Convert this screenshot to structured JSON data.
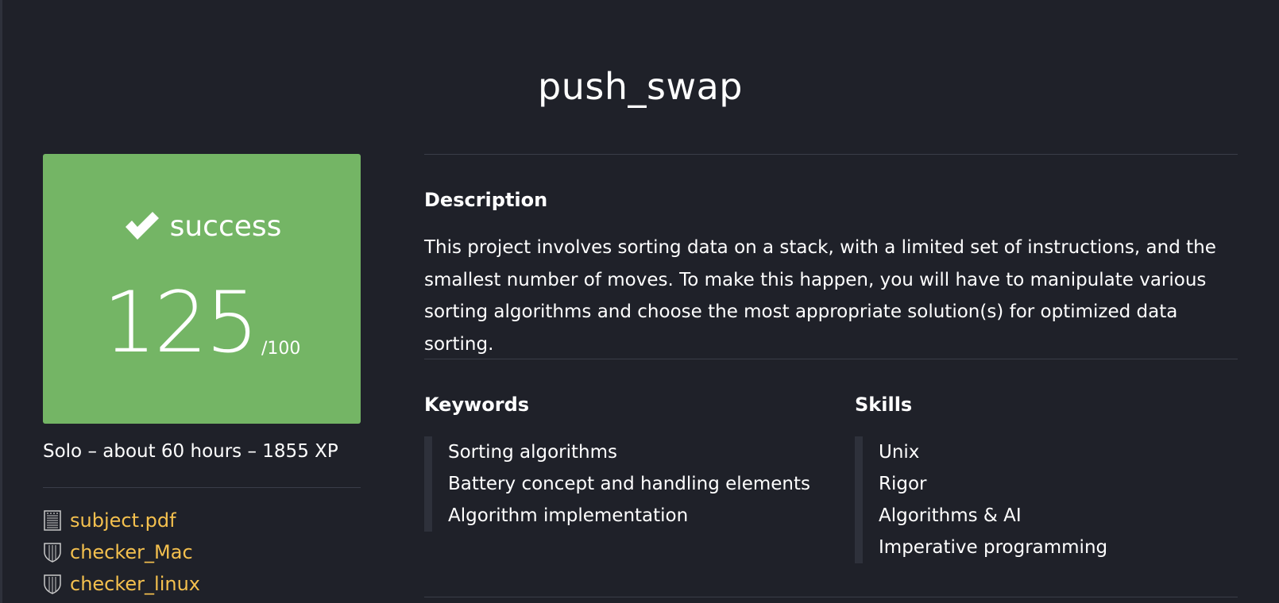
{
  "project": {
    "title": "push_swap"
  },
  "result": {
    "status": "success",
    "score": "125",
    "max": "/100",
    "status_color": "#74b565"
  },
  "meta": "Solo – about 60 hours – 1855 XP",
  "files": [
    {
      "icon": "document-icon",
      "label": "subject.pdf"
    },
    {
      "icon": "shield-icon",
      "label": "checker_Mac"
    },
    {
      "icon": "shield-icon",
      "label": "checker_linux"
    }
  ],
  "description": {
    "heading": "Description",
    "text": "This project involves sorting data on a stack, with a limited set of instructions, and the smallest number of moves. To make this happen, you will have to manipulate various sorting algorithms and choose the most appropriate solution(s) for optimized data sorting."
  },
  "keywords": {
    "heading": "Keywords",
    "items": [
      "Sorting algorithms",
      "Battery concept and handling elements",
      "Algorithm implementation"
    ]
  },
  "skills": {
    "heading": "Skills",
    "items": [
      "Unix",
      "Rigor",
      "Algorithms & AI",
      "Imperative programming"
    ]
  },
  "colors": {
    "background": "#1f2129",
    "link": "#f4c04e",
    "divider": "#3a3d48"
  }
}
